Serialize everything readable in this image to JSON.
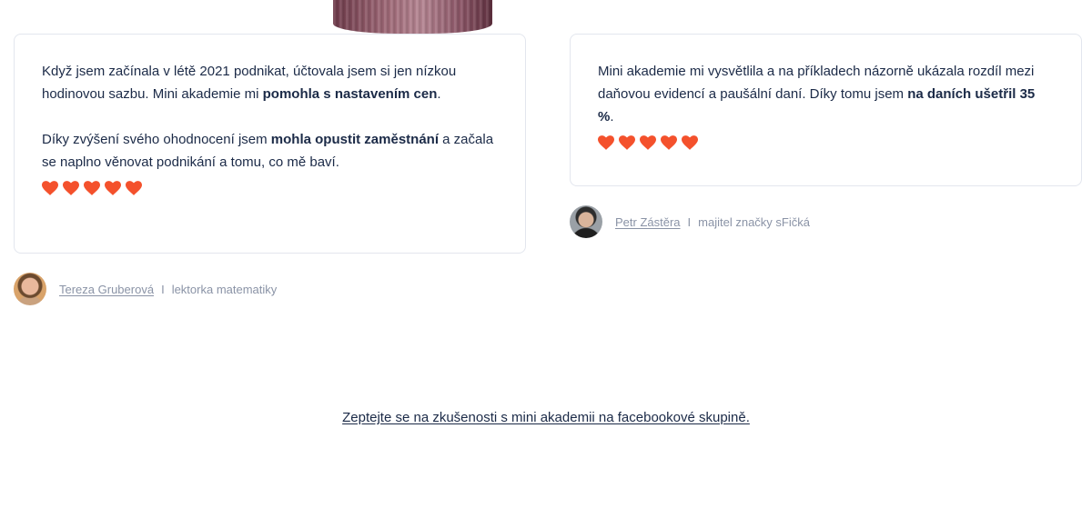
{
  "testimonials": [
    {
      "paragraphs": [
        {
          "parts": [
            {
              "text": "Když jsem začínala v létě 2021 podnikat, účtovala jsem si jen nízkou hodinovou sazbu. Mini akademie mi ",
              "bold": false
            },
            {
              "text": "pomohla s nastavením cen",
              "bold": true
            },
            {
              "text": ".",
              "bold": false
            }
          ]
        },
        {
          "parts": [
            {
              "text": "Díky zvýšení svého ohodnocení jsem ",
              "bold": false
            },
            {
              "text": "mohla opustit zaměstnání",
              "bold": true
            },
            {
              "text": " a začala se naplno věnovat podnikání a tomu, co mě baví.",
              "bold": false
            }
          ]
        }
      ],
      "rating": 5,
      "rating_max": 5,
      "heart_color": "#f4512c",
      "author": {
        "name": "Tereza Gruberová",
        "separator": "I",
        "role": "lektorka matematiky"
      }
    },
    {
      "paragraphs": [
        {
          "parts": [
            {
              "text": "Mini akademie mi vysvětlila a na příkladech názorně ukázala rozdíl mezi daňovou evidencí a paušální daní. Díky tomu jsem ",
              "bold": false
            },
            {
              "text": "na daních ušetřil 35 %",
              "bold": true
            },
            {
              "text": ".",
              "bold": false
            }
          ]
        }
      ],
      "rating": 5,
      "rating_max": 5,
      "heart_color": "#f4512c",
      "author": {
        "name": "Petr Zástěra",
        "separator": "I",
        "role": "majitel značky sFičká"
      }
    }
  ],
  "cta": {
    "label": "Zeptejte se na zkušenosti s mini akademii na facebookové skupině."
  },
  "colors": {
    "text": "#1b2a47",
    "muted": "#8a93a6",
    "heart": "#f4512c",
    "card_border": "#e3e6ee"
  }
}
